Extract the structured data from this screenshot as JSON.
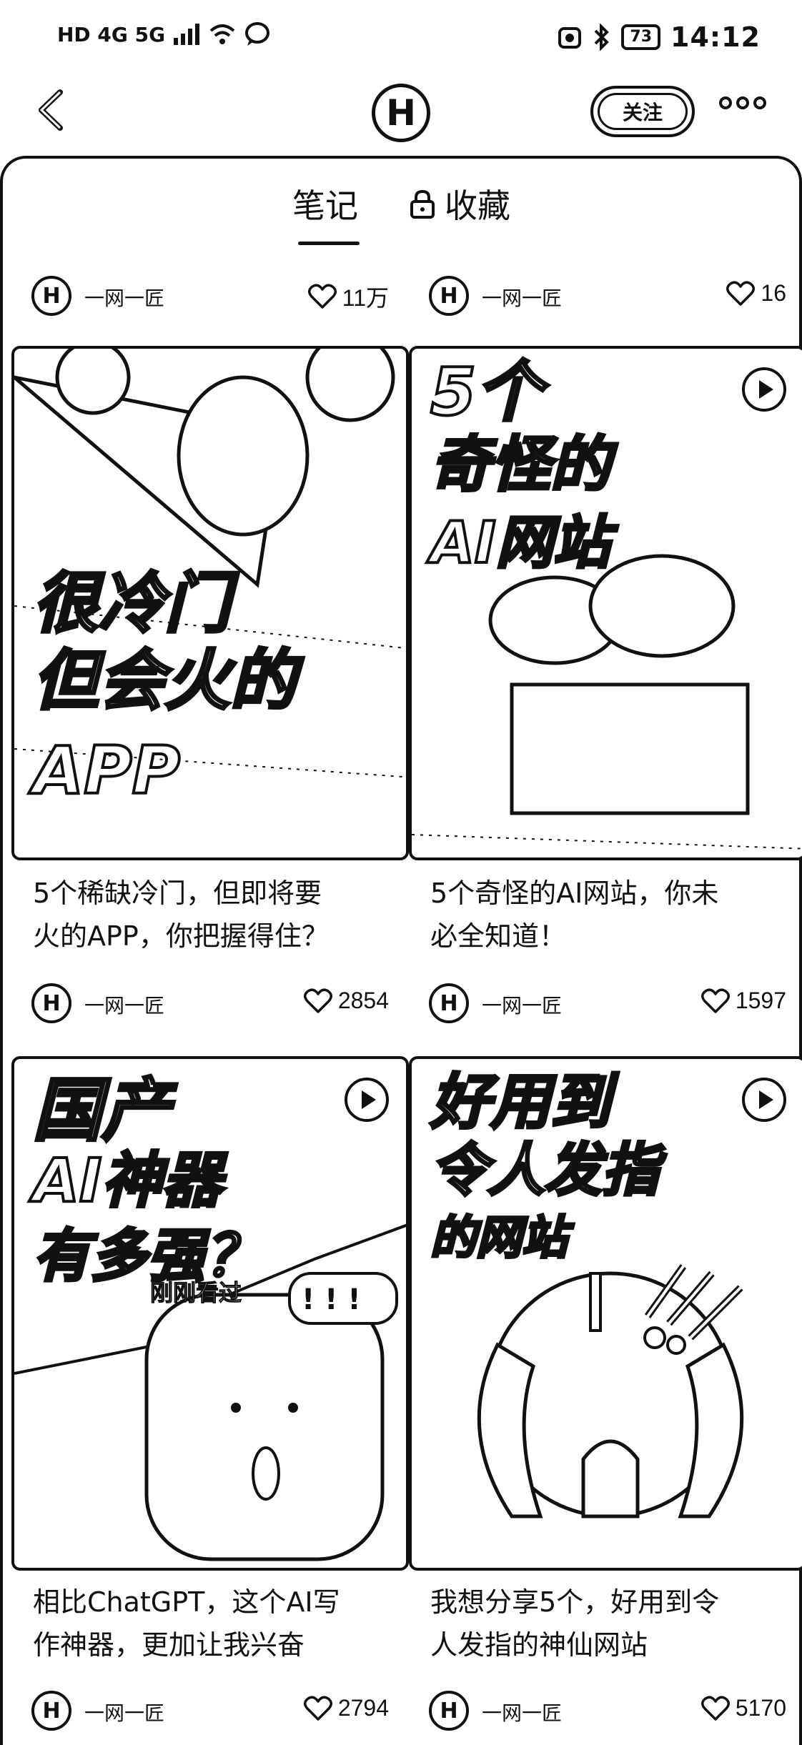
{
  "status": {
    "left_icons": "HD 4G 5G",
    "time": "14:12",
    "battery": "73"
  },
  "nav": {
    "logo_text": "H",
    "follow_label": "关注"
  },
  "tabs": {
    "notes": "笔记",
    "favorites": "收藏"
  },
  "cards": [
    {
      "author": "一网一匠",
      "likes": "11万"
    },
    {
      "author": "一网一匠",
      "likes": "16"
    },
    {
      "author": "一网一匠",
      "likes": "2854",
      "cover_lines": [
        "很冷门",
        "但会火的",
        "APP"
      ],
      "caption_lines": [
        "5个稀缺冷门，但即将要",
        "火的APP，你把握得住？"
      ]
    },
    {
      "author": "一网一匠",
      "likes": "1597",
      "cover_lines": [
        "5个",
        "奇怪的",
        "AI网站"
      ],
      "caption_lines": [
        "5个奇怪的AI网站，你未",
        "必全知道！"
      ]
    },
    {
      "author": "一网一匠",
      "likes": "2794",
      "cover_lines": [
        "国产",
        "AI神器",
        "有多强？"
      ],
      "watched": "刚刚看过",
      "caption_lines": [
        "相比ChatGPT，这个AI写",
        "作神器，更加让我兴奋"
      ]
    },
    {
      "author": "一网一匠",
      "likes": "5170",
      "cover_lines": [
        "好用到",
        "令人发指",
        "的网站"
      ],
      "caption_lines": [
        "我想分享5个，好用到令",
        "人发指的神仙网站"
      ]
    }
  ]
}
